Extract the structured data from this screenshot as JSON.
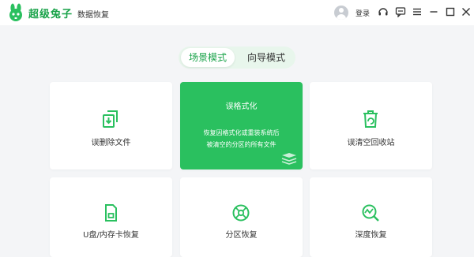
{
  "app": {
    "brand": "超级兔子",
    "product": "数据恢复"
  },
  "titlebar": {
    "login_label": "登录",
    "icons": [
      "support-icon",
      "feedback-icon",
      "menu-icon",
      "minimize-icon",
      "maximize-icon",
      "close-icon"
    ]
  },
  "modes": {
    "scene": "场景模式",
    "wizard": "向导模式",
    "active": "scene"
  },
  "cards": {
    "deleted": "误删除文件",
    "format_title": "误格式化",
    "format_desc_1": "恢复因格式化或重装系统后",
    "format_desc_2": "被清空的分区的所有文件",
    "recycle": "误清空回收站",
    "usb": "U盘/内存卡恢复",
    "partition": "分区恢复",
    "deep": "深度恢复"
  },
  "colors": {
    "accent": "#2ac05f",
    "accent_text": "#1aa34a",
    "mode_bg": "#e8f6ec",
    "background": "#f4f5f7"
  }
}
